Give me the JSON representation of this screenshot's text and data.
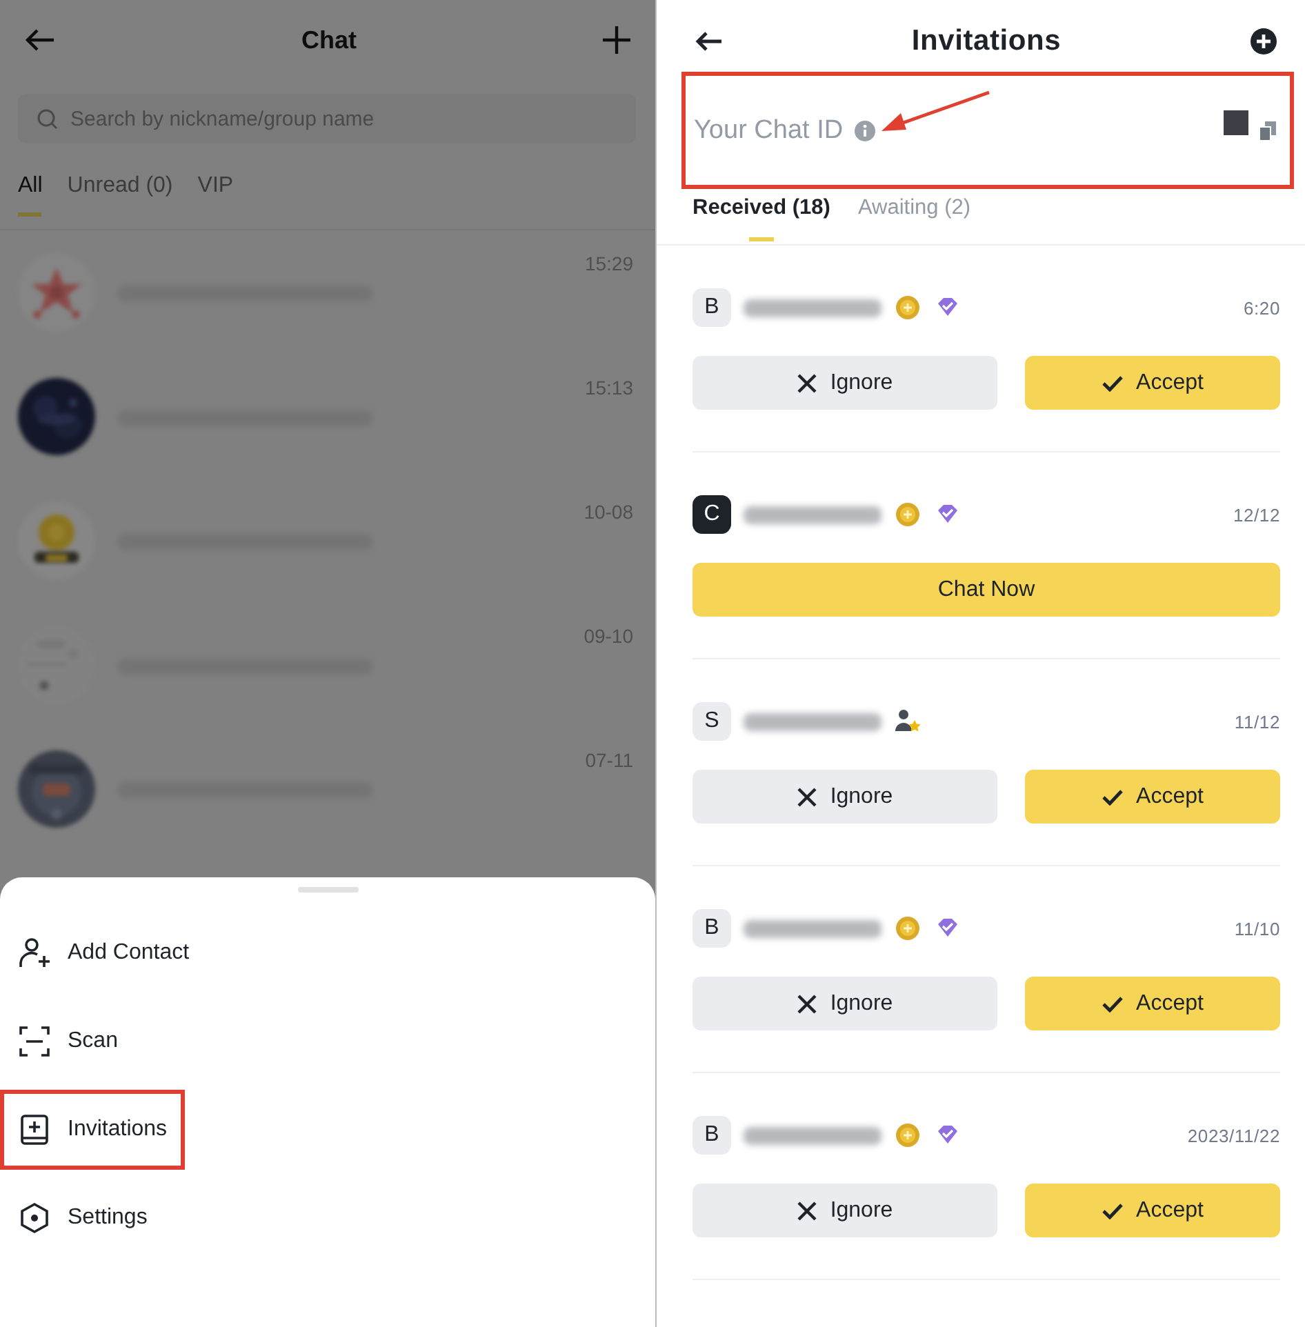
{
  "chat_screen": {
    "title": "Chat",
    "search": {
      "placeholder": "Search by nickname/group name"
    },
    "tabs": [
      {
        "label": "All",
        "selected": true
      },
      {
        "label": "Unread (0)",
        "selected": false
      },
      {
        "label": "VIP",
        "selected": false
      }
    ],
    "conversations": [
      {
        "time": "15:29"
      },
      {
        "time": "15:13"
      },
      {
        "time": "10-08"
      },
      {
        "time": "09-10"
      },
      {
        "time": "07-11"
      }
    ]
  },
  "menu_sheet": {
    "items": [
      {
        "label": "Add Contact",
        "kind": "add-contact",
        "highlighted": false
      },
      {
        "label": "Scan",
        "kind": "scan",
        "highlighted": false
      },
      {
        "label": "Invitations",
        "kind": "invitations",
        "highlighted": true
      },
      {
        "label": "Settings",
        "kind": "settings",
        "highlighted": false
      }
    ]
  },
  "invitations_screen": {
    "title": "Invitations",
    "chat_id": {
      "label": "Your Chat ID",
      "highlighted": true
    },
    "tabs": [
      {
        "label": "Received (18)",
        "selected": true
      },
      {
        "label": "Awaiting (2)",
        "selected": false
      }
    ],
    "invitations": [
      {
        "initial": "B",
        "dark_avatar": false,
        "badges": [
          {
            "kind": "coin"
          },
          {
            "kind": "diamond"
          }
        ],
        "time": "6:20",
        "actions": [
          {
            "label": "Ignore",
            "kind": "ignore"
          },
          {
            "label": "Accept",
            "kind": "accept"
          }
        ]
      },
      {
        "initial": "C",
        "dark_avatar": true,
        "badges": [
          {
            "kind": "coin"
          },
          {
            "kind": "diamond"
          }
        ],
        "time": "12/12",
        "actions": [
          {
            "label": "Chat Now",
            "kind": "chat"
          }
        ]
      },
      {
        "initial": "S",
        "dark_avatar": false,
        "badges": [
          {
            "kind": "person-star"
          }
        ],
        "time": "11/12",
        "actions": [
          {
            "label": "Ignore",
            "kind": "ignore"
          },
          {
            "label": "Accept",
            "kind": "accept"
          }
        ]
      },
      {
        "initial": "B",
        "dark_avatar": false,
        "badges": [
          {
            "kind": "coin"
          },
          {
            "kind": "diamond"
          }
        ],
        "time": "11/10",
        "actions": [
          {
            "label": "Ignore",
            "kind": "ignore"
          },
          {
            "label": "Accept",
            "kind": "accept"
          }
        ]
      },
      {
        "initial": "B",
        "dark_avatar": false,
        "badges": [
          {
            "kind": "coin"
          },
          {
            "kind": "diamond"
          }
        ],
        "time": "2023/11/22",
        "actions": [
          {
            "label": "Ignore",
            "kind": "ignore"
          },
          {
            "label": "Accept",
            "kind": "accept"
          }
        ]
      }
    ]
  }
}
